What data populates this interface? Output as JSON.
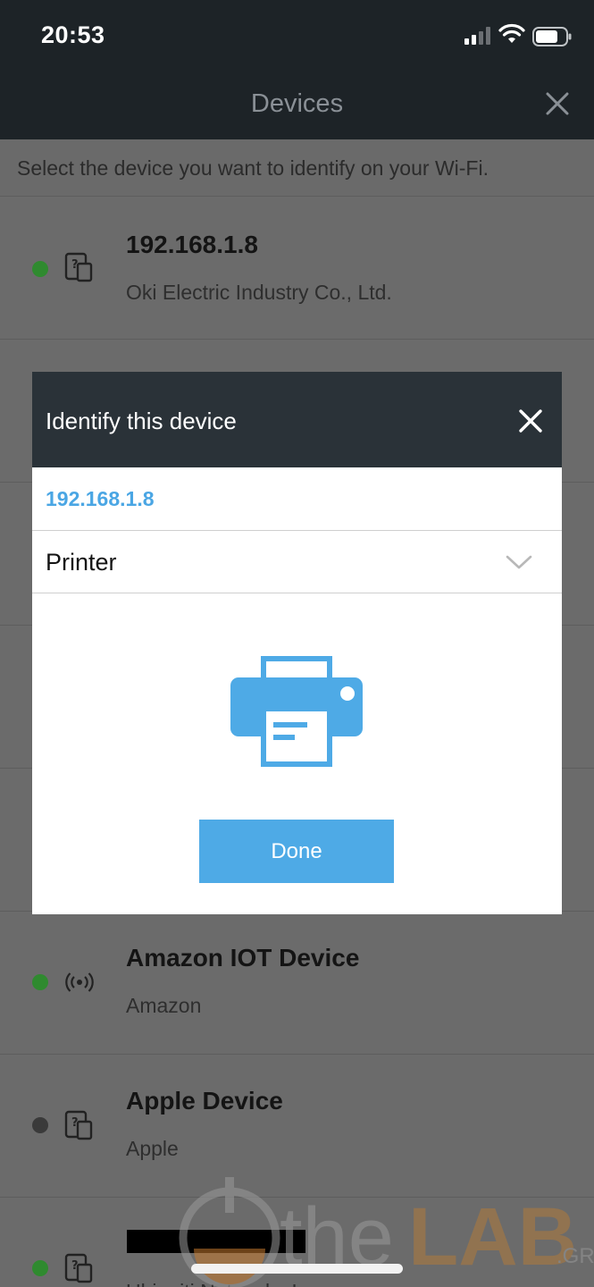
{
  "status_bar": {
    "time": "20:53",
    "icons": [
      "cellular-signal-icon",
      "wifi-icon",
      "battery-icon"
    ]
  },
  "nav": {
    "title": "Devices",
    "close_icon": "close-icon"
  },
  "instruction": "Select the device you want to identify on your Wi-Fi.",
  "devices": [
    {
      "name": "192.168.1.8",
      "vendor": "Oki Electric Industry Co., Ltd.",
      "status_color": "#2f8a2f",
      "icon": "unknown-device-icon"
    },
    {
      "name": "Amazon IOT Device",
      "vendor": "Amazon",
      "status_color": "#2f8a2f",
      "icon": "iot-broadcast-icon"
    },
    {
      "name": "Apple Device",
      "vendor": "Apple",
      "status_color": "#3a3a3a",
      "icon": "unknown-device-icon"
    },
    {
      "name": "",
      "vendor": "Ubiquiti Networks Inc.",
      "status_color": "#2f8a2f",
      "icon": "unknown-device-icon"
    }
  ],
  "modal": {
    "title": "Identify this device",
    "ip": "192.168.1.8",
    "selected_type": "Printer",
    "illustration": "printer-icon",
    "done_label": "Done"
  },
  "watermark": {
    "text_the": "the",
    "text_lab": "LAB",
    "text_gr": ".GR"
  },
  "colors": {
    "header_bg": "#1d2327",
    "modal_header_bg": "#2a3238",
    "accent_blue": "#4aa6e4",
    "done_button": "#4eaae6",
    "online_dot": "#2f8a2f"
  }
}
